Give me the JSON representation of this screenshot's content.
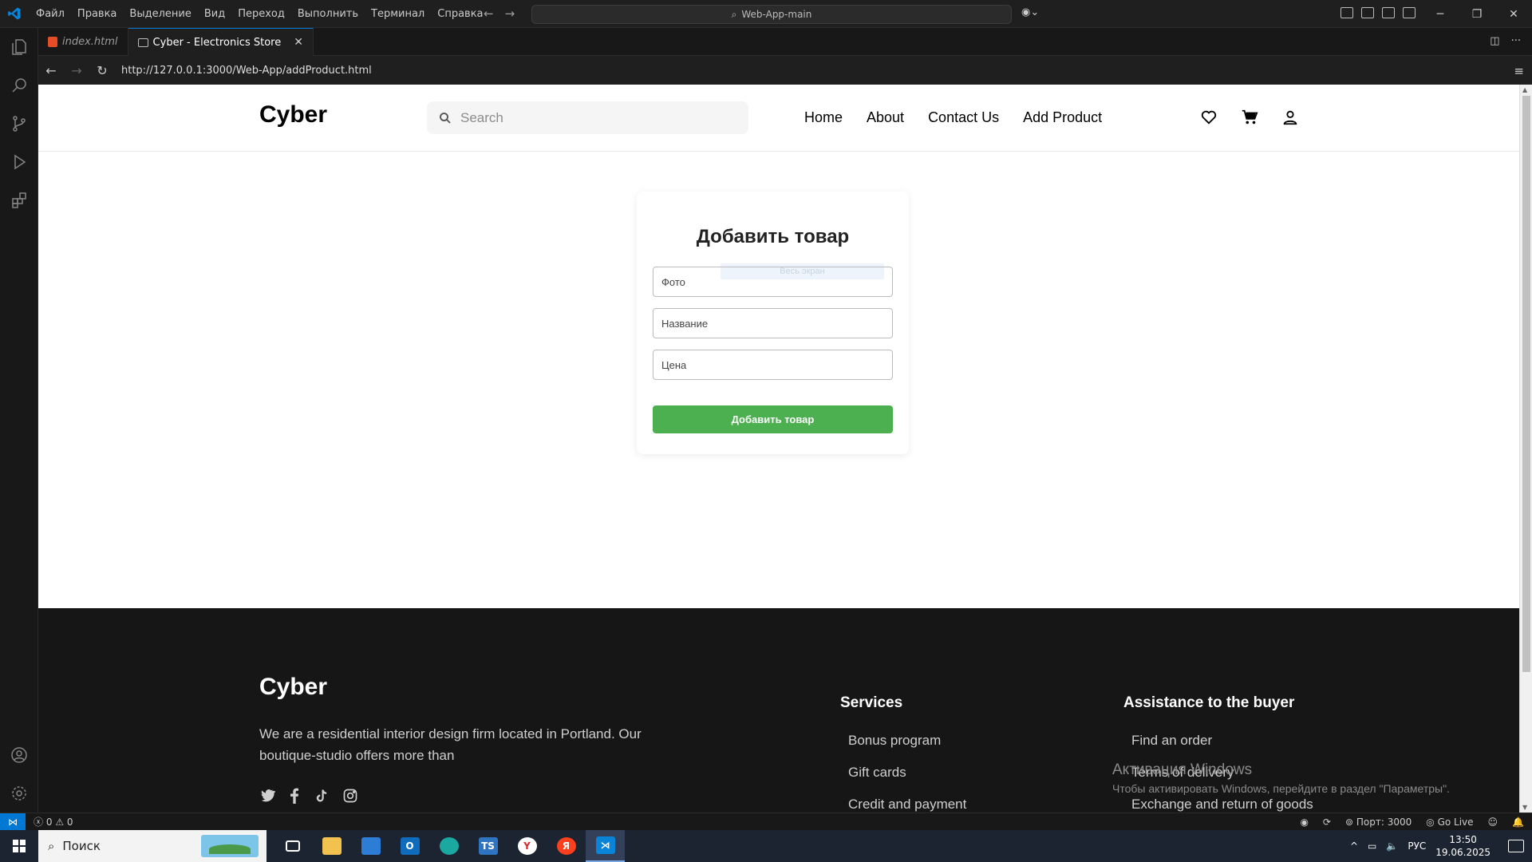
{
  "titlebar": {
    "menu": [
      "Файл",
      "Правка",
      "Выделение",
      "Вид",
      "Переход",
      "Выполнить",
      "Терминал",
      "Справка"
    ],
    "command_center": "Web-App-main"
  },
  "tabs": [
    {
      "label": "index.html",
      "active": false
    },
    {
      "label": "Cyber - Electronics Store",
      "active": true
    }
  ],
  "browser": {
    "url": "http://127.0.0.1:3000/Web-App/addProduct.html"
  },
  "site": {
    "logo": "Cyber",
    "search_placeholder": "Search",
    "nav": [
      "Home",
      "About",
      "Contact Us",
      "Add Product"
    ],
    "form": {
      "title": "Добавить товар",
      "overlay_hint": "Весь экран",
      "photo_placeholder": "Фото",
      "name_placeholder": "Название",
      "price_placeholder": "Цена",
      "submit_label": "Добавить товар",
      "submit_color": "#4caf50"
    },
    "footer": {
      "logo": "Cyber",
      "about": "We are a residential interior design firm located in Portland. Our boutique-studio offers more than",
      "services_title": "Services",
      "services": [
        "Bonus program",
        "Gift cards",
        "Credit and payment"
      ],
      "assistance_title": "Assistance to the buyer",
      "assistance": [
        "Find an order",
        "Terms of delivery",
        "Exchange and return of goods"
      ]
    }
  },
  "watermark": {
    "line1": "Активация Windows",
    "line2": "Чтобы активировать Windows, перейдите в раздел \"Параметры\"."
  },
  "statusbar": {
    "errors": "0",
    "warnings": "0",
    "port": "Порт: 3000",
    "go_live": "Go Live"
  },
  "taskbar": {
    "search_label": "Поиск",
    "language": "РУС",
    "time": "13:50",
    "date": "19.06.2025"
  },
  "colors": {
    "accent": "#0078d4",
    "footer_bg": "#161616"
  }
}
